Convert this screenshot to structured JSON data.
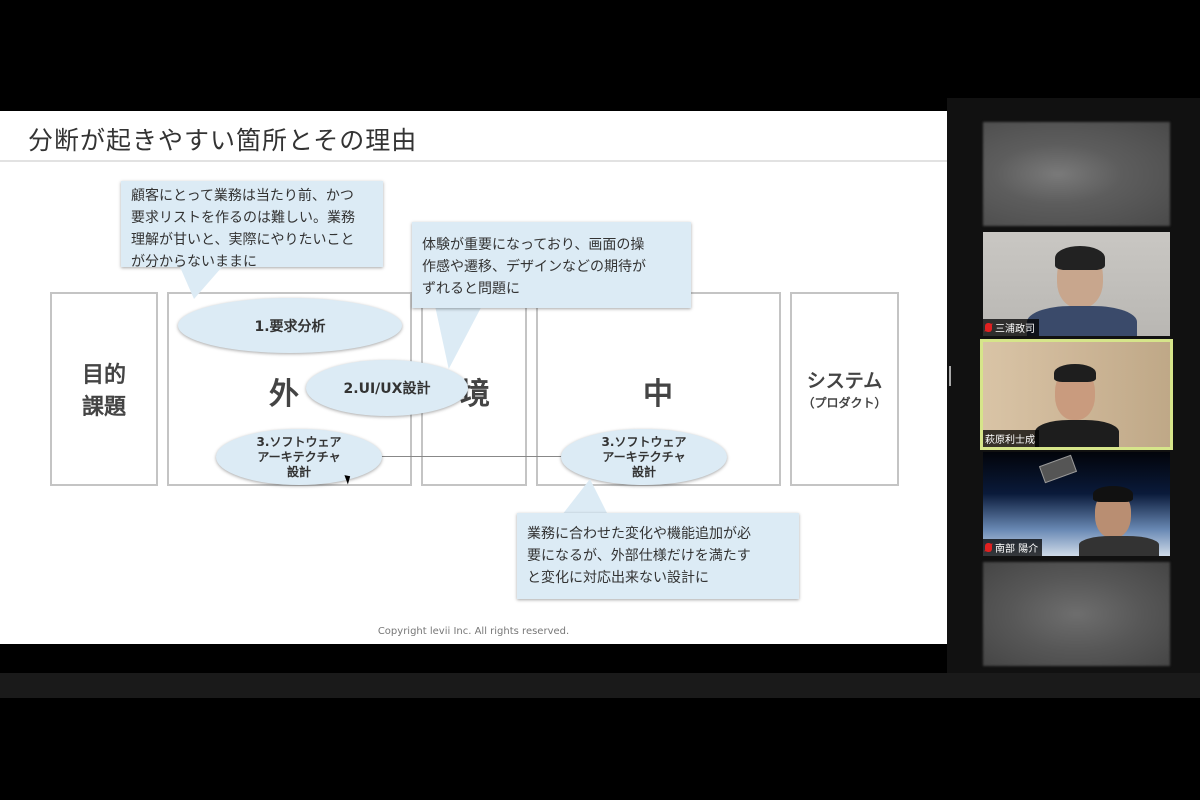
{
  "slide": {
    "title": "分断が起きやすい箇所とその理由",
    "copyright": "Copyright levii Inc. All rights reserved.",
    "boxes": {
      "purpose_line1": "目的",
      "purpose_line2": "課題",
      "outer_char": "外",
      "env_char": "境",
      "middle_char": "中",
      "system_label": "システム",
      "system_sub": "（プロダクト）"
    },
    "ellipses": {
      "requirements": "1.要求分析",
      "uiux": "2.UI/UX設計",
      "arch_left_line1": "3.ソフトウェア",
      "arch_left_line2": "アーキテクチャ",
      "arch_left_line3": "設計",
      "arch_right_line1": "3.ソフトウェア",
      "arch_right_line2": "アーキテクチャ",
      "arch_right_line3": "設計"
    },
    "callouts": {
      "c1_line1": "顧客にとって業務は当たり前、かつ",
      "c1_line2": "要求リストを作るのは難しい。業務",
      "c1_line3": "理解が甘いと、実際にやりたいこと",
      "c1_line4": "が分からないままに",
      "c2_line1": "体験が重要になっており、画面の操",
      "c2_line2": "作感や遷移、デザインなどの期待が",
      "c2_line3": "ずれると問題に",
      "c3_line1": "業務に合わせた変化や機能追加が必",
      "c3_line2": "要になるが、外部仕様だけを満たす",
      "c3_line3": "と変化に対応出来ない設計に"
    }
  },
  "participants": [
    {
      "name": "",
      "muted": false
    },
    {
      "name": "三浦政司",
      "muted": true
    },
    {
      "name": "萩原利士成",
      "muted": false,
      "active_speaker": true
    },
    {
      "name": "南部 陽介",
      "muted": true
    },
    {
      "name": "",
      "muted": false
    }
  ],
  "colors": {
    "callout_bg": "#dcebf5",
    "active_border": "#d6e58a",
    "mute_red": "#e02020"
  }
}
